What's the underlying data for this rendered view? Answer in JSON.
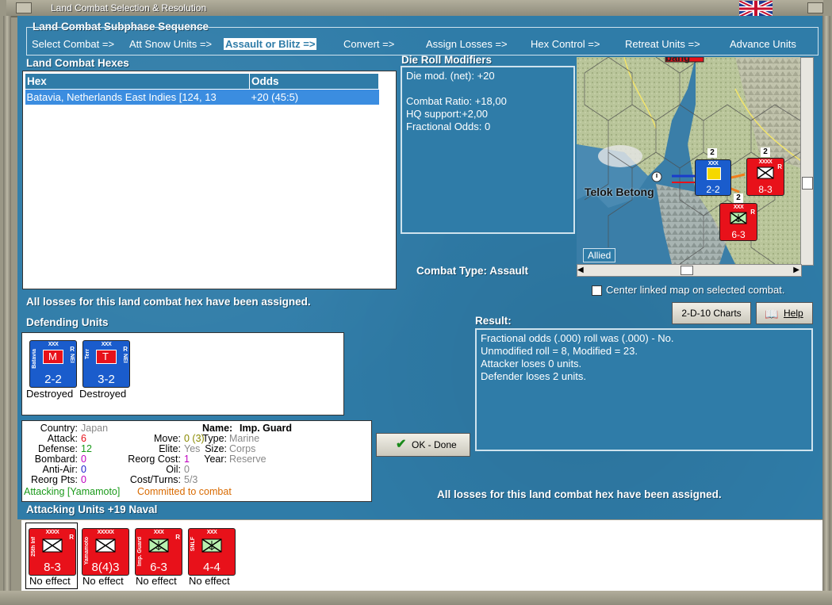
{
  "window": {
    "title": "Land Combat Selection & Resolution"
  },
  "colors": {
    "accent_red": "#e8111a",
    "allied_blue": "#1a5ccc",
    "water": "#2f7ca8",
    "highlight": "#3b8de0"
  },
  "subphase": {
    "header": "Land Combat Subphase Sequence",
    "steps": [
      "Select Combat =>",
      "Att Snow Units =>",
      "Assault or Blitz =>",
      "Convert =>",
      "Assign Losses =>",
      "Hex Control =>",
      "Retreat Units =>",
      "Advance Units"
    ],
    "active_index": 2
  },
  "hexes": {
    "header": "Land Combat Hexes",
    "columns": [
      "Hex",
      "Odds"
    ],
    "rows": [
      {
        "hex": "Batavia, Netherlands East Indies [124, 13",
        "odds": "+20 (45:5)"
      }
    ]
  },
  "die_roll": {
    "header": "Die Roll Modifiers",
    "lines": [
      "Die mod. (net): +20",
      "",
      "Combat Ratio: +18,00",
      "HQ support:+2,00",
      "Fractional Odds: 0"
    ]
  },
  "map": {
    "label_telok": "Telok Betong",
    "label_top": "bang",
    "tab": "Allied",
    "stack_counts": [
      "2",
      "2",
      "2"
    ]
  },
  "combat_type": {
    "label": "Combat Type:",
    "value": "Assault"
  },
  "center_map": {
    "label": "Center linked map on selected combat.",
    "checked": false
  },
  "losses_msg": "All losses for this land combat hex have been assigned.",
  "buttons": {
    "charts": "2-D-10 Charts",
    "help": "Help",
    "ok": "OK - Done"
  },
  "result": {
    "header": "Result:",
    "lines": [
      "Fractional odds (.000) roll was (.000)  - No.",
      "Unmodified roll = 8, Modified = 23.",
      "Attacker loses 0 units.",
      "Defender loses 2 units."
    ]
  },
  "defending": {
    "header": "Defending Units",
    "units": [
      {
        "size": "XXX",
        "name": "Batavia",
        "side": "R",
        "side2": "NEI",
        "letter": "M",
        "strength": "2-2",
        "status": "Destroyed"
      },
      {
        "size": "XXX",
        "name": "Terr",
        "side": "R",
        "side2": "NEI",
        "letter": "T",
        "strength": "3-2",
        "status": "Destroyed"
      }
    ]
  },
  "info": {
    "country_l": "Country:",
    "country_v": "Japan",
    "attack_l": "Attack:",
    "attack_v": "6",
    "defense_l": "Defense:",
    "defense_v": "12",
    "bombard_l": "Bombard:",
    "bombard_v": "0",
    "antiair_l": "Anti-Air:",
    "antiair_v": "0",
    "reorg_l": "Reorg Pts:",
    "reorg_v": "0",
    "name_l": "Name:",
    "name_v": "Imp. Guard",
    "move_l": "Move:",
    "move_v": "0 (3)",
    "elite_l": "Elite:",
    "elite_v": "Yes",
    "reorgcost_l": "Reorg Cost:",
    "reorgcost_v": "1",
    "oil_l": "Oil:",
    "oil_v": "0",
    "costturns_l": "Cost/Turns:",
    "costturns_v": "5/3",
    "type_l": "Type:",
    "type_v": "Marine",
    "size_l": "Size:",
    "size_v": "Corps",
    "year_l": "Year:",
    "year_v": "Reserve",
    "attacking_v": "Attacking [Yamamoto]",
    "committed_v": "Committed to combat"
  },
  "attacking": {
    "header": "Attacking Units +19 Naval",
    "units": [
      {
        "size": "XXXX",
        "name": "25th Inf",
        "side": "R",
        "strength": "8-3",
        "status": "No effect",
        "symbol": "inf"
      },
      {
        "size": "XXXXX",
        "name": "Yamamoto",
        "side": "",
        "strength": "8(4)3",
        "status": "No effect",
        "symbol": "inf"
      },
      {
        "size": "XXX",
        "name": "Imp. Guard",
        "side": "R",
        "strength": "6-3",
        "status": "No effect",
        "symbol": "marine"
      },
      {
        "size": "XXX",
        "name": "SNLF",
        "side": "",
        "strength": "4-4",
        "status": "No effect",
        "symbol": "marine"
      }
    ]
  },
  "map_units": [
    {
      "size": "XXX",
      "name": "Batavia",
      "strength": "2-2"
    },
    {
      "size": "XXXX",
      "name": "25th Inf",
      "side": "R",
      "strength": "8-3"
    },
    {
      "size": "XXX",
      "name": "Imp. Guard",
      "side": "R",
      "strength": "6-3"
    }
  ]
}
